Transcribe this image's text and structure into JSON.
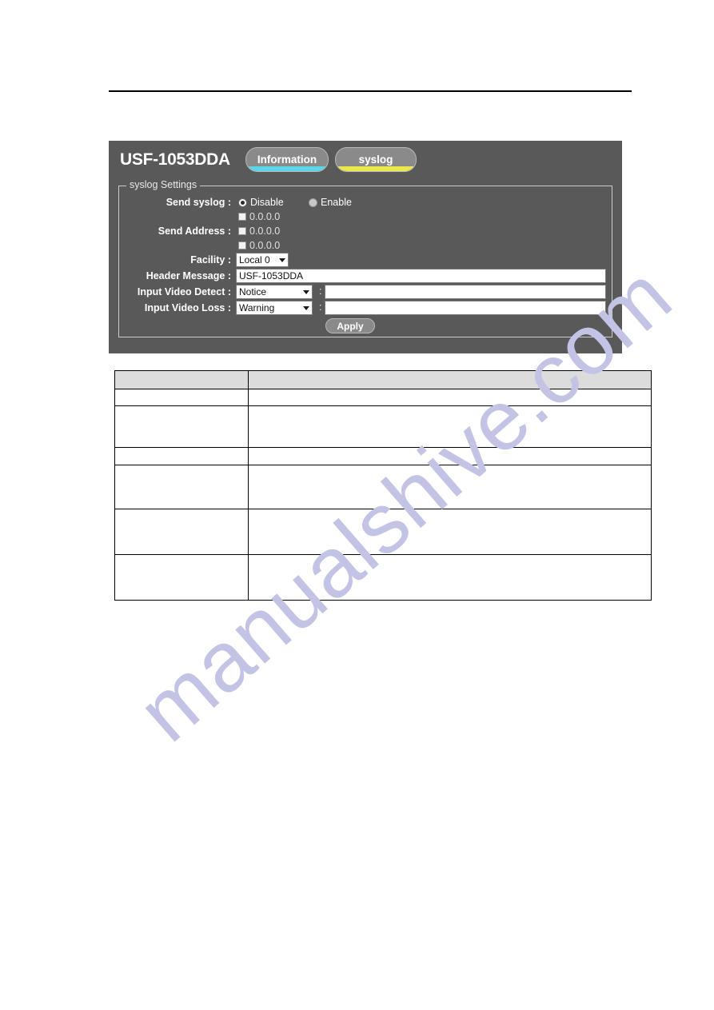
{
  "page": {
    "top_rule": "horizontal-rule"
  },
  "device_panel": {
    "device_title": "USF-1053DDA",
    "colors": {
      "panel_background": "#595959",
      "tab_background": "#8a8a8a",
      "information_underline": "#5bd5e8",
      "syslog_underline": "#ede84a",
      "text": "#ffffff"
    },
    "tabs": [
      {
        "label": "Information",
        "underline_color": "#5bd5e8",
        "active": false
      },
      {
        "label": "syslog",
        "underline_color": "#ede84a",
        "active": true
      }
    ],
    "fieldset": {
      "legend": "syslog Settings",
      "rows": {
        "send_syslog": {
          "label": "Send syslog :",
          "options": [
            {
              "label": "Disable",
              "selected": true
            },
            {
              "label": "Enable",
              "selected": false
            }
          ]
        },
        "send_address": {
          "label": "Send Address :",
          "entries": [
            {
              "value": "0.0.0.0",
              "checked": false
            },
            {
              "value": "0.0.0.0",
              "checked": false
            },
            {
              "value": "0.0.0.0",
              "checked": false
            }
          ]
        },
        "facility": {
          "label": "Facility :",
          "value": "Local 0"
        },
        "header_message": {
          "label": "Header Message :",
          "value": "USF-1053DDA"
        },
        "input_video_detect": {
          "label": "Input Video Detect :",
          "severity": "Notice",
          "separator": ":",
          "message": ""
        },
        "input_video_loss": {
          "label": "Input Video Loss :",
          "severity": "Warning",
          "separator": ":",
          "message": ""
        }
      },
      "apply_label": "Apply"
    }
  },
  "description_table": {
    "headers": [
      "",
      ""
    ],
    "rows": [
      {
        "term": "",
        "description": ""
      },
      {
        "term": "",
        "description": ""
      },
      {
        "term": "",
        "description": ""
      },
      {
        "term": "",
        "description": ""
      },
      {
        "term": "",
        "description": ""
      },
      {
        "term": "",
        "description": ""
      }
    ]
  },
  "watermark": {
    "text": "manualshive.com",
    "color": "#c3c3e6"
  }
}
